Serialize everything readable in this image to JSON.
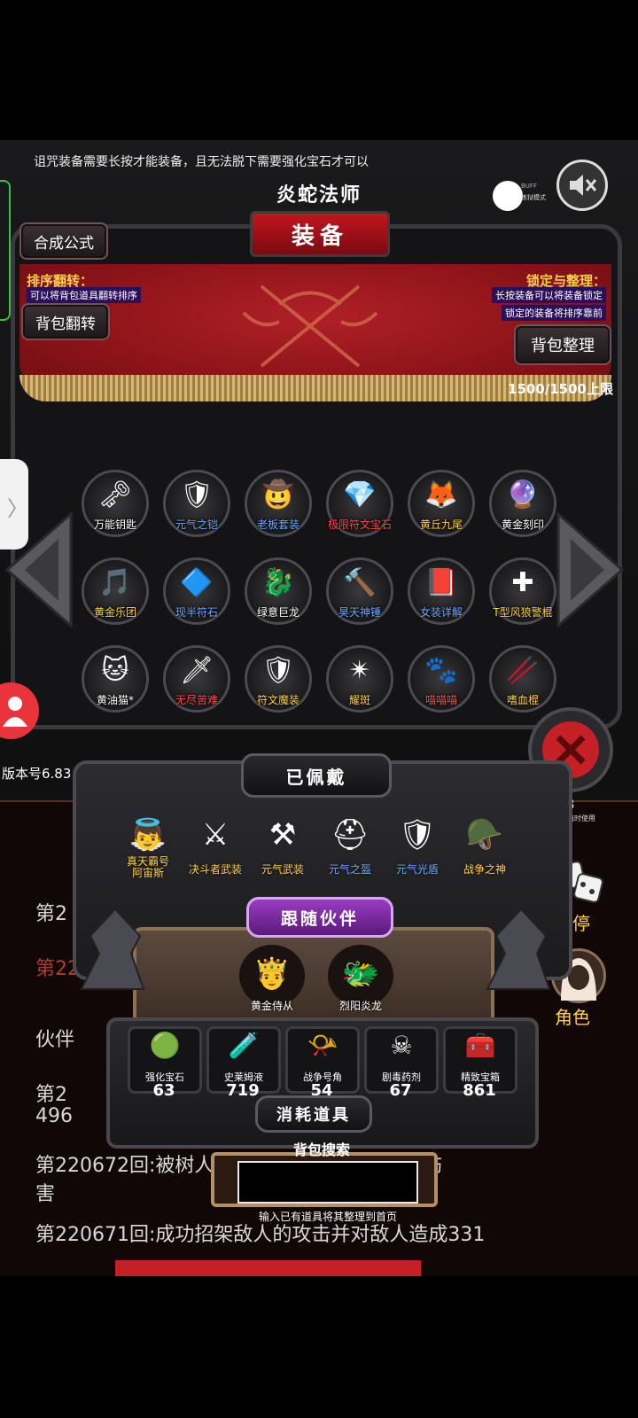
{
  "warning": "诅咒装备需要长按才能装备，且无法脱下需要强化宝石才可以",
  "header": {
    "subtitle": "炎蛇法师",
    "title": "装备"
  },
  "buttons": {
    "synth_formula": "合成公式",
    "bag_flip": "背包翻转",
    "bag_sort": "背包整理"
  },
  "left_info": {
    "label": "排序翻转：",
    "desc": "可以将背包道具翻转排序"
  },
  "right_info": {
    "label": "锁定与整理：",
    "desc1": "长按装备可以将装备锁定",
    "desc2": "锁定的装备将排序靠前"
  },
  "capacity": "1500/1500上限",
  "buff_label": "BUFF",
  "mode_label": "炼狱模式",
  "inventory": [
    {
      "label": "万能钥匙",
      "color": "#ffffff",
      "icon": "key-icon"
    },
    {
      "label": "元气之铠",
      "color": "#6fa8ff",
      "icon": "armor-icon"
    },
    {
      "label": "老板套装",
      "color": "#6fa8ff",
      "icon": "suit-icon"
    },
    {
      "label": "极限符文宝石",
      "color": "#ff4a4a",
      "icon": "gem-icon"
    },
    {
      "label": "黄丘九尾",
      "color": "#ffd24a",
      "icon": "fox-icon"
    },
    {
      "label": "黄金刻印",
      "color": "#ffffff",
      "icon": "seal-icon"
    },
    {
      "label": "黄金乐团",
      "color": "#ffd24a",
      "icon": "harp-icon"
    },
    {
      "label": "现半符石",
      "color": "#6fa8ff",
      "icon": "rune-icon"
    },
    {
      "label": "绿意巨龙",
      "color": "#ffffff",
      "icon": "dragon-icon"
    },
    {
      "label": "昊天神锤",
      "color": "#6fa8ff",
      "icon": "hammer-icon"
    },
    {
      "label": "女装详解",
      "color": "#6fa8ff",
      "icon": "book-icon"
    },
    {
      "label": "T型风狼警棍",
      "color": "#ffd24a",
      "icon": "baton-icon"
    },
    {
      "label": "黄油猫*",
      "color": "#ffffff",
      "icon": "cat-icon"
    },
    {
      "label": "无尽苦难",
      "color": "#ff4a4a",
      "icon": "sword-icon"
    },
    {
      "label": "符文魔装",
      "color": "#ffd24a",
      "icon": "armor-icon"
    },
    {
      "label": "耀斑",
      "color": "#ffd24a",
      "icon": "flare-icon"
    },
    {
      "label": "喵喵喵",
      "color": "#ff4a4a",
      "icon": "paw-icon"
    },
    {
      "label": "嗜血棍",
      "color": "#ffd24a",
      "icon": "staff-icon"
    }
  ],
  "equipped": {
    "tab": "已佩戴",
    "items": [
      {
        "label": "真天霸号\n阿宙斯",
        "color": "#ffd24a",
        "icon": "wings-icon"
      },
      {
        "label": "决斗者武装",
        "color": "#ffd24a",
        "icon": "knight-icon"
      },
      {
        "label": "元气武装",
        "color": "#ffd24a",
        "icon": "weapon-icon"
      },
      {
        "label": "元气之盔",
        "color": "#6fa8ff",
        "icon": "helmet-icon"
      },
      {
        "label": "元气光盾",
        "color": "#6fa8ff",
        "icon": "shield-icon"
      },
      {
        "label": "战争之神",
        "color": "#ffd24a",
        "icon": "war-god-icon"
      }
    ]
  },
  "companions": {
    "tab": "跟随伙伴",
    "items": [
      {
        "label": "黄金侍从",
        "icon": "squire-icon"
      },
      {
        "label": "烈阳炎龙",
        "icon": "fire-dragon-icon"
      }
    ]
  },
  "consumables": {
    "tab": "消耗道具",
    "items": [
      {
        "label": "强化宝石",
        "count": "63",
        "icon": "green-gem-icon"
      },
      {
        "label": "史莱姆液",
        "count": "719",
        "icon": "potion-icon"
      },
      {
        "label": "战争号角",
        "count": "54",
        "icon": "horn-icon"
      },
      {
        "label": "剧毒药剂",
        "count": "67",
        "icon": "poison-icon"
      },
      {
        "label": "精致宝箱",
        "count": "861",
        "icon": "chest-icon"
      }
    ]
  },
  "search": {
    "title": "背包搜索",
    "hint": "输入已有道具将其整理到首页",
    "value": ""
  },
  "side": {
    "version": "版本号6.83",
    "pause": "暂停",
    "role": "角色",
    "stat_value": "78",
    "stat_label": "共数值时使用"
  },
  "log": {
    "line1": "第2",
    "line2": "第2206",
    "line3": "伙伴",
    "line4": "第2",
    "line5": "496",
    "line6": "第220672回:被树人命中受到127142247点伤",
    "line7": "害",
    "line8": "第220671回:成功招架敌人的攻击并对敌人造成331"
  }
}
